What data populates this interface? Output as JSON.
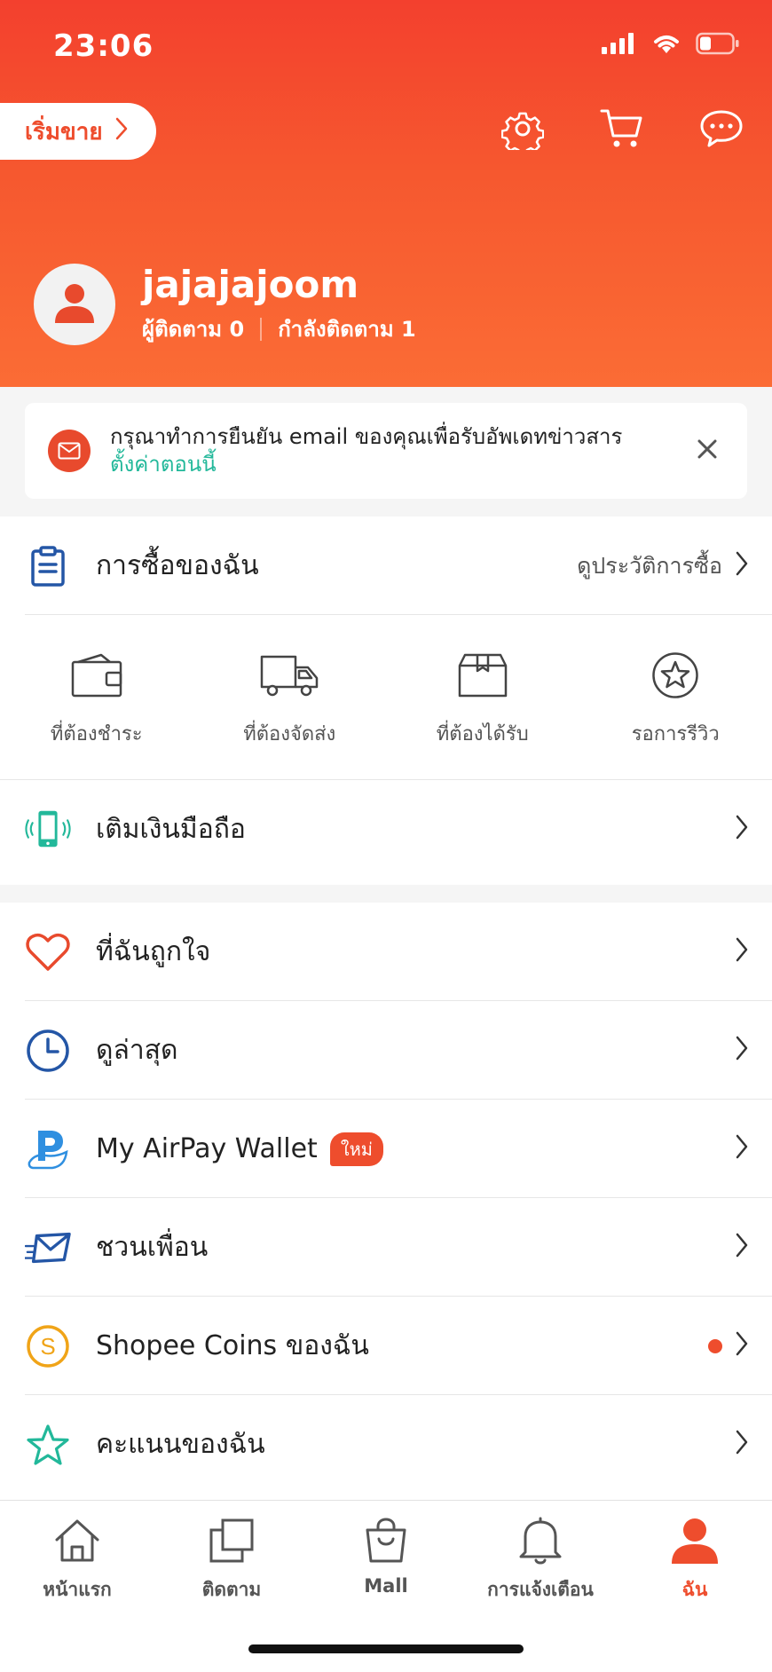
{
  "status_bar": {
    "time": "23:06"
  },
  "header": {
    "start_selling_label": "เริ่มขาย",
    "icons": [
      "gear-icon",
      "cart-icon",
      "chat-icon"
    ]
  },
  "profile": {
    "username": "jajajajoom",
    "followers_label": "ผู้ติดตาม",
    "followers_count": "0",
    "following_label": "กำลังติดตาม",
    "following_count": "1"
  },
  "banner": {
    "message": "กรุณาทำการยืนยัน email ของคุณเพื่อรับอัพเดทข่าวสาร",
    "link": "ตั้งค่าตอนนี้"
  },
  "purchases": {
    "title": "การซื้อของฉัน",
    "history_link": "ดูประวัติการซื้อ",
    "statuses": [
      {
        "label": "ที่ต้องชำระ",
        "icon": "wallet-icon"
      },
      {
        "label": "ที่ต้องจัดส่ง",
        "icon": "truck-icon"
      },
      {
        "label": "ที่ต้องได้รับ",
        "icon": "box-icon"
      },
      {
        "label": "รอการรีวิว",
        "icon": "star-circle-icon"
      }
    ]
  },
  "topup": {
    "label": "เติมเงินมือถือ"
  },
  "menu": [
    {
      "label": "ที่ฉันถูกใจ",
      "icon": "heart-icon"
    },
    {
      "label": "ดูล่าสุด",
      "icon": "clock-icon"
    },
    {
      "label": "My AirPay Wallet",
      "icon": "airpay-icon",
      "badge": "ใหม่"
    },
    {
      "label": "ชวนเพื่อน",
      "icon": "envelope-fast-icon"
    },
    {
      "label": "Shopee Coins ของฉัน",
      "icon": "coin-icon"
    },
    {
      "label": "คะแนนของฉัน",
      "icon": "star-icon"
    }
  ],
  "bottom_nav": [
    {
      "label": "หน้าแรก",
      "icon": "home-icon"
    },
    {
      "label": "ติดตาม",
      "icon": "feed-icon"
    },
    {
      "label": "Mall",
      "icon": "mall-bag-icon"
    },
    {
      "label": "การแจ้งเตือน",
      "icon": "bell-icon"
    },
    {
      "label": "ฉัน",
      "icon": "user-icon",
      "active": true
    }
  ],
  "colors": {
    "brand": "#ee4d2d",
    "link": "#22b89a",
    "blue": "#2456a6"
  }
}
